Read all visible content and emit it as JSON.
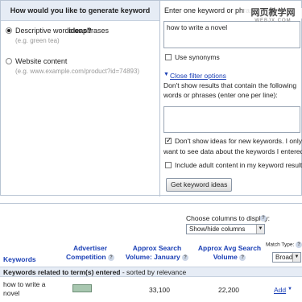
{
  "generate": {
    "heading": "How would you like to generate keyword ideas?",
    "option1": {
      "label": "Descriptive words or phrases",
      "hint": "(e.g. green tea)",
      "selected": true
    },
    "option2": {
      "label": "Website content",
      "hint": "(e.g. www.example.com/product?id=74893)",
      "selected": false
    }
  },
  "entry": {
    "heading": "Enter one keyword or phras",
    "keywords_value": "how to write a novel",
    "use_synonyms": "Use synonyms",
    "close_filter": "Close filter options",
    "filter_desc_1": "Don't show results that contain the following",
    "filter_desc_2": "words or phrases (enter one per line):",
    "dont_show_1": "Don't show ideas for new keywords. I only",
    "dont_show_2": "want to see data about the keywords I entered.",
    "adult": "Include adult content in my keyword results",
    "button": "Get keyword ideas"
  },
  "watermark": {
    "main": "网页教学网",
    "sub": "WEBJX.COM"
  },
  "columns": {
    "choose_label": "Choose columns to display:",
    "select_value": "Show/hide columns",
    "keywords": "Keywords",
    "advertiser_competition_1": "Advertiser",
    "advertiser_competition_2": "Competition",
    "search_volume_1": "Approx Search",
    "search_volume_2": "Volume: January",
    "avg_search_1": "Approx Avg Search",
    "avg_search_2": "Volume",
    "match_type_label": "Match Type:",
    "match_type_value": "Broad",
    "help": "?"
  },
  "results": {
    "related_heading": "Keywords related to term(s) entered",
    "sorted": " - sorted by relevance",
    "rows": [
      {
        "keyword": "how to write a novel",
        "competition": 0.3,
        "search_volume": "33,100",
        "avg_volume": "22,200",
        "action": "Add"
      }
    ]
  }
}
